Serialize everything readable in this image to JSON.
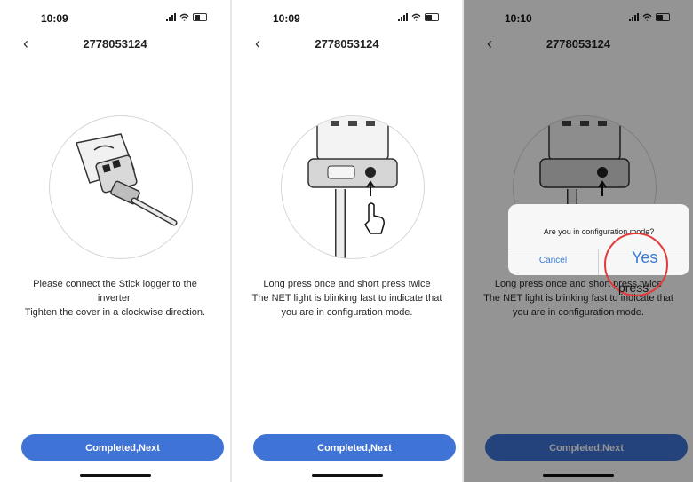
{
  "screens": [
    {
      "time": "10:09",
      "title": "2778053124",
      "description": [
        "Please connect the Stick logger to the",
        "inverter.",
        "Tighten the cover in a clockwise direction."
      ],
      "button": "Completed,Next"
    },
    {
      "time": "10:09",
      "title": "2778053124",
      "description": [
        "Long press once and short press twice",
        "The NET light is blinking fast to indicate that",
        "you are in configuration mode."
      ],
      "button": "Completed,Next"
    },
    {
      "time": "10:10",
      "title": "2778053124",
      "description": [
        "Long press once and short press twice",
        "The NET light is blinking fast to indicate that",
        "you are in configuration mode."
      ],
      "button": "Completed,Next",
      "dialog": {
        "question": "Are you in configuration mode?",
        "cancel": "Cancel",
        "yes": "Yes"
      },
      "annotation": "press"
    }
  ],
  "colors": {
    "primary_button": "#3f73d6",
    "dialog_action": "#3a7bd5",
    "highlight_ring": "#e23a3a"
  },
  "icons": [
    "back-chevron-icon",
    "signal-icon",
    "wifi-icon",
    "battery-icon",
    "pointing-hand-icon",
    "arrow-up-icon"
  ]
}
